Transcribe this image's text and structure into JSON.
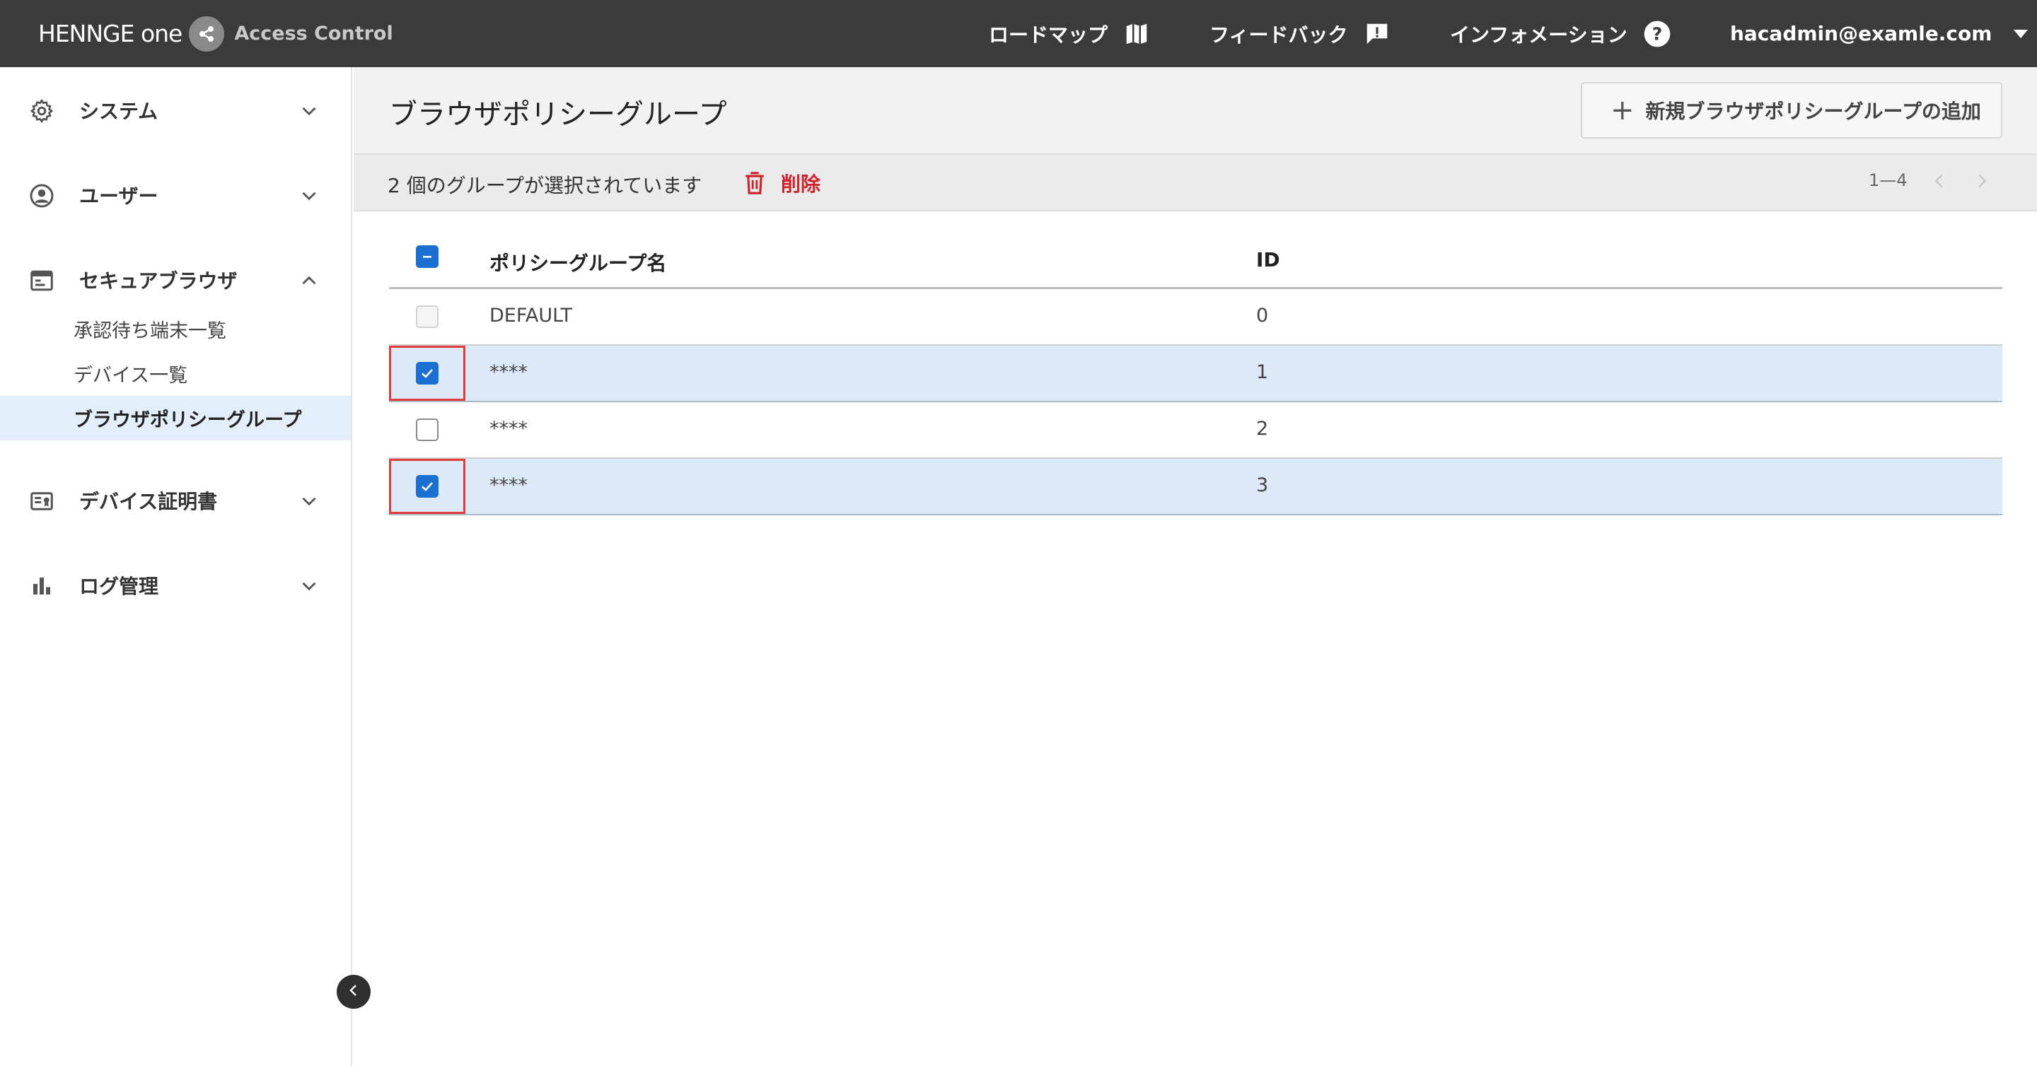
{
  "header": {
    "brand_name": "HENNGE one",
    "product_name": "Access Control",
    "nav": {
      "roadmap": "ロードマップ",
      "feedback": "フィードバック",
      "information": "インフォメーション",
      "user_email": "hacadmin@examle.com"
    }
  },
  "sidebar": {
    "groups": [
      {
        "label": "システム",
        "icon": "gear-icon",
        "expanded": false
      },
      {
        "label": "ユーザー",
        "icon": "user-circle-icon",
        "expanded": false
      },
      {
        "label": "セキュアブラウザ",
        "icon": "browser-icon",
        "expanded": true,
        "items": [
          {
            "label": "承認待ち端末一覧",
            "active": false
          },
          {
            "label": "デバイス一覧",
            "active": false
          },
          {
            "label": "ブラウザポリシーグループ",
            "active": true
          }
        ]
      },
      {
        "label": "デバイス証明書",
        "icon": "certificate-icon",
        "expanded": false
      },
      {
        "label": "ログ管理",
        "icon": "bar-chart-icon",
        "expanded": false
      }
    ]
  },
  "main": {
    "title": "ブラウザポリシーグループ",
    "add_button": "新規ブラウザポリシーグループの追加",
    "selection_text": "2 個のグループが選択されています",
    "delete_label": "削除",
    "pagination": "1—4",
    "table": {
      "columns": [
        "ポリシーグループ名",
        "ID"
      ],
      "rows": [
        {
          "name": "DEFAULT",
          "id": "0",
          "checked": false,
          "disabled": true,
          "highlighted": false
        },
        {
          "name": "****",
          "id": "1",
          "checked": true,
          "disabled": false,
          "highlighted": true
        },
        {
          "name": "****",
          "id": "2",
          "checked": false,
          "disabled": false,
          "highlighted": false
        },
        {
          "name": "****",
          "id": "3",
          "checked": true,
          "disabled": false,
          "highlighted": true
        }
      ]
    }
  },
  "colors": {
    "topbar": "#3b3b3b",
    "accent": "#1a6fd1",
    "selected_row": "#dbe9f8",
    "delete_red": "#d0202a",
    "highlight_border": "#e23b3b"
  }
}
